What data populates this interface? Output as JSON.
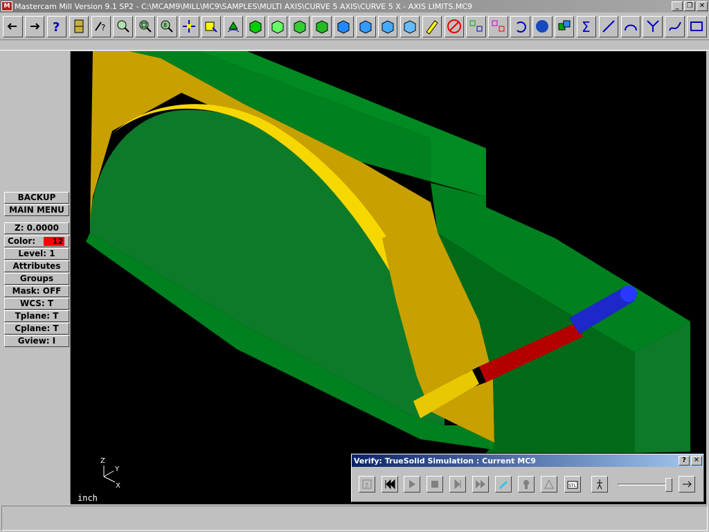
{
  "window": {
    "title": "Mastercam Mill Version 9.1 SP2 - C:\\MCAM9\\MILL\\MC9\\SAMPLES\\MULTI AXIS\\CURVE 5 AXIS\\CURVE 5 X - AXIS LIMITS.MC9",
    "icon": "mastercam-app-icon",
    "controls": [
      "_",
      "❐",
      "✕"
    ]
  },
  "toolbar": {
    "buttons": [
      {
        "name": "back-arrow-icon"
      },
      {
        "name": "forward-arrow-icon"
      },
      {
        "name": "help-icon"
      },
      {
        "name": "file-cabinet-icon"
      },
      {
        "name": "analyze-icon"
      },
      {
        "name": "zoom-window-icon"
      },
      {
        "name": "unzoom-icon"
      },
      {
        "name": "zoom-fit-icon"
      },
      {
        "name": "pan-icon"
      },
      {
        "name": "screen-select-icon"
      },
      {
        "name": "rotate-view-icon"
      },
      {
        "name": "view-top-icon"
      },
      {
        "name": "view-front-icon"
      },
      {
        "name": "view-side-icon"
      },
      {
        "name": "view-iso-icon"
      },
      {
        "name": "cplane-top-icon"
      },
      {
        "name": "cplane-front-icon"
      },
      {
        "name": "cplane-side-icon"
      },
      {
        "name": "cplane-3d-icon"
      },
      {
        "name": "repaint-icon"
      },
      {
        "name": "clear-colors-icon"
      },
      {
        "name": "translate-icon"
      },
      {
        "name": "mirror-icon"
      },
      {
        "name": "undo-icon"
      },
      {
        "name": "shade-sphere-icon"
      },
      {
        "name": "solids-icon"
      },
      {
        "name": "sum-icon"
      },
      {
        "name": "line-icon"
      },
      {
        "name": "arc-icon"
      },
      {
        "name": "fillet-icon"
      },
      {
        "name": "spline-icon"
      },
      {
        "name": "rectangle-icon"
      }
    ]
  },
  "menu": {
    "backup": "BACKUP",
    "main_menu": "MAIN MENU",
    "z": "Z:  0.0000",
    "color_label": "Color:",
    "color_value": "12",
    "color_hex": "#ff0000",
    "level": "Level:  1",
    "attributes": "Attributes",
    "groups": "Groups",
    "mask": "Mask:  OFF",
    "wcs": "WCS:  T",
    "tplane": "Tplane:  T",
    "cplane": "Cplane:  T",
    "gview": "Gview:  I"
  },
  "viewport": {
    "units": "inch",
    "axes": {
      "z": "Z",
      "y": "Y",
      "x": "X"
    },
    "colors": {
      "stock": "#00801e",
      "stock_dark": "#006a18",
      "stock_side": "#0d7a2a",
      "part": "#c8a000",
      "part_light": "#f6d800",
      "tool_holder": "#1e28c8",
      "tool_shank": "#b40000"
    }
  },
  "verify": {
    "title": "Verify: TrueSolid Simulation : Current MC9",
    "help": "?",
    "close": "✕",
    "buttons": [
      {
        "name": "options-icon"
      },
      {
        "name": "rewind-icon"
      },
      {
        "name": "play-icon"
      },
      {
        "name": "stop-icon"
      },
      {
        "name": "step-icon"
      },
      {
        "name": "fast-forward-icon"
      },
      {
        "name": "display-tool-icon"
      },
      {
        "name": "display-holder-icon"
      },
      {
        "name": "view-icon"
      },
      {
        "name": "save-stl-icon"
      },
      {
        "name": "speed-slow-icon"
      },
      {
        "name": "speed-fast-icon"
      }
    ],
    "speed_level": 0.95
  }
}
